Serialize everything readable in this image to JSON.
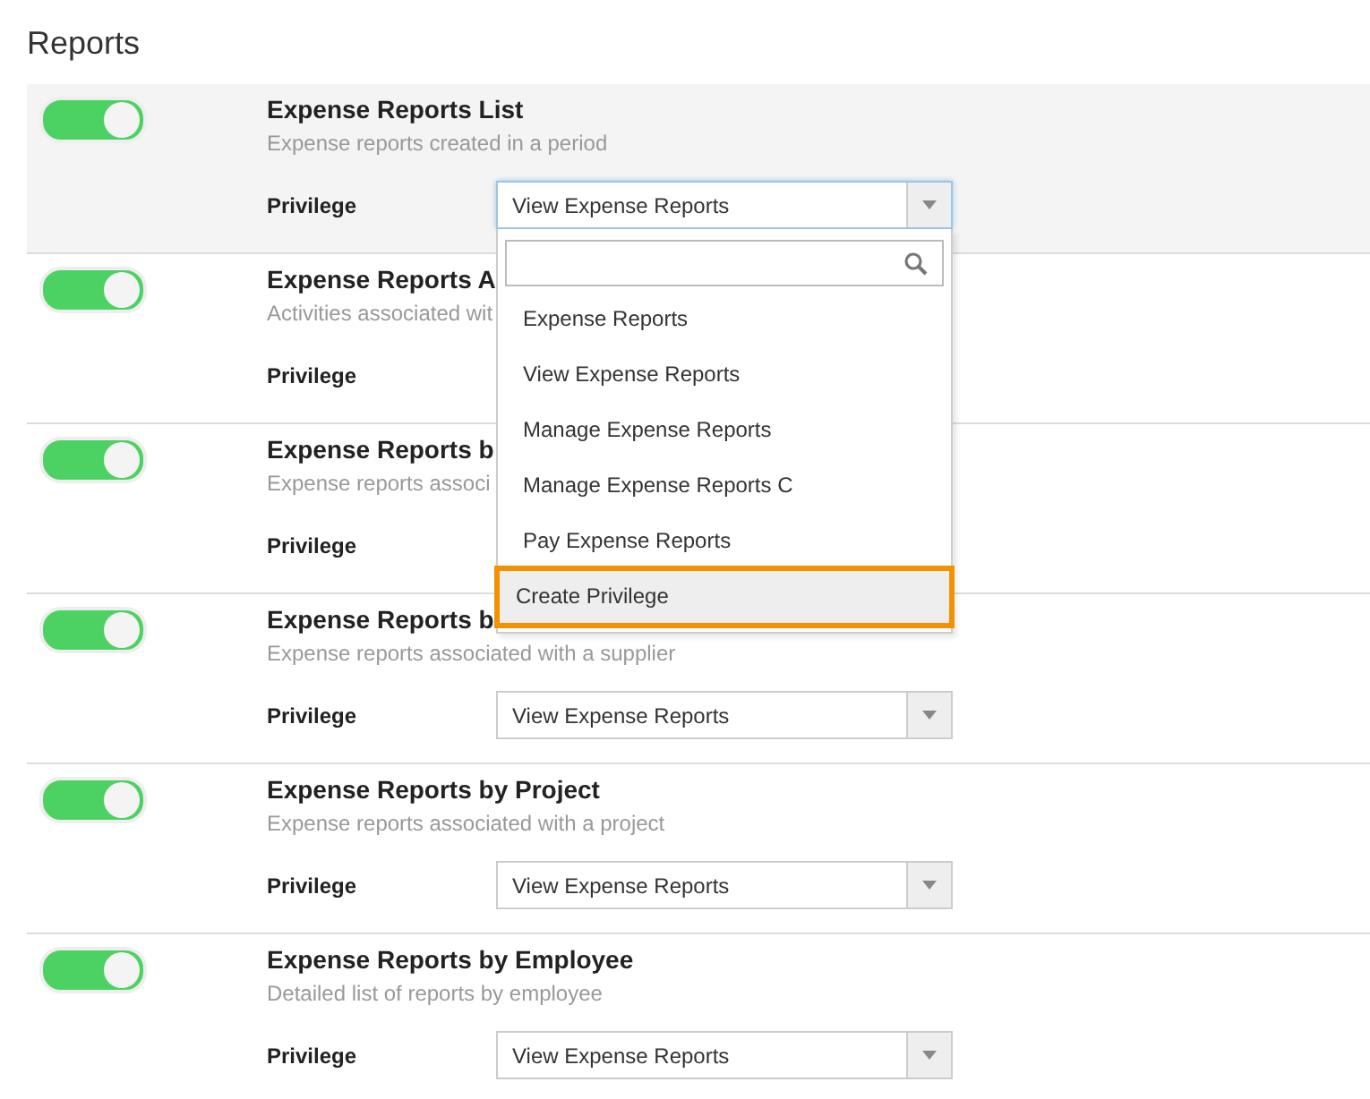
{
  "heading": "Reports",
  "reports": [
    {
      "title": "Expense Reports List",
      "subtitle": "Expense reports created in a period",
      "on": true,
      "highlighted": true,
      "privilege_label": "Privilege",
      "privilege_value": "View Expense Reports",
      "open": true
    },
    {
      "title": "Expense Reports A",
      "subtitle": "Activities associated wit",
      "on": true,
      "highlighted": false,
      "privilege_label": "Privilege",
      "open": false
    },
    {
      "title": "Expense Reports b",
      "subtitle": "Expense reports associ",
      "on": true,
      "highlighted": false,
      "privilege_label": "Privilege",
      "open": false
    },
    {
      "title": "Expense Reports b",
      "subtitle": "Expense reports associated with a supplier",
      "on": true,
      "highlighted": false,
      "privilege_label": "Privilege",
      "privilege_value": "View Expense Reports",
      "open": false
    },
    {
      "title": "Expense Reports by Project",
      "subtitle": "Expense reports associated with a project",
      "on": true,
      "highlighted": false,
      "privilege_label": "Privilege",
      "privilege_value": "View Expense Reports",
      "open": false
    },
    {
      "title": "Expense Reports by Employee",
      "subtitle": "Detailed list of reports by employee",
      "on": true,
      "highlighted": false,
      "privilege_label": "Privilege",
      "privilege_value": "View Expense Reports",
      "open": false
    }
  ],
  "dropdown": {
    "options": [
      {
        "label": "Expense Reports",
        "highlighted": false
      },
      {
        "label": "View Expense Reports",
        "highlighted": false
      },
      {
        "label": "Manage Expense Reports",
        "highlighted": false
      },
      {
        "label": "Manage Expense Reports C",
        "highlighted": false
      },
      {
        "label": "Pay Expense Reports",
        "highlighted": false
      },
      {
        "label": "Create Privilege",
        "highlighted": true
      }
    ]
  }
}
